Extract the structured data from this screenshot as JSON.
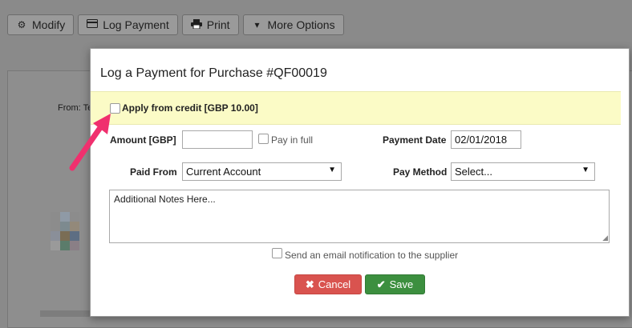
{
  "toolbar": {
    "modify_label": "Modify",
    "log_payment_label": "Log Payment",
    "print_label": "Print",
    "more_options_label": "More Options"
  },
  "background": {
    "from_label": "From: Te"
  },
  "modal": {
    "title": "Log a Payment for Purchase #QF00019",
    "credit": {
      "label": "Apply from credit [GBP 10.00]",
      "checked": false
    },
    "amount": {
      "label": "Amount [GBP]",
      "value": "",
      "pay_in_full_label": "Pay in full",
      "pay_in_full_checked": false
    },
    "payment_date": {
      "label": "Payment Date",
      "value": "02/01/2018"
    },
    "paid_from": {
      "label": "Paid From",
      "selected": "Current Account"
    },
    "pay_method": {
      "label": "Pay Method",
      "selected": "Select..."
    },
    "notes": {
      "placeholder": "Additional Notes Here..."
    },
    "email_notification": {
      "label": "Send an email notification to the supplier",
      "checked": false
    },
    "buttons": {
      "cancel_label": "Cancel",
      "save_label": "Save"
    }
  },
  "colors": {
    "credit_highlight": "#fbfbc6",
    "cancel": "#d9534f",
    "save": "#3c8f3f",
    "annotation_arrow": "#f0306e"
  }
}
